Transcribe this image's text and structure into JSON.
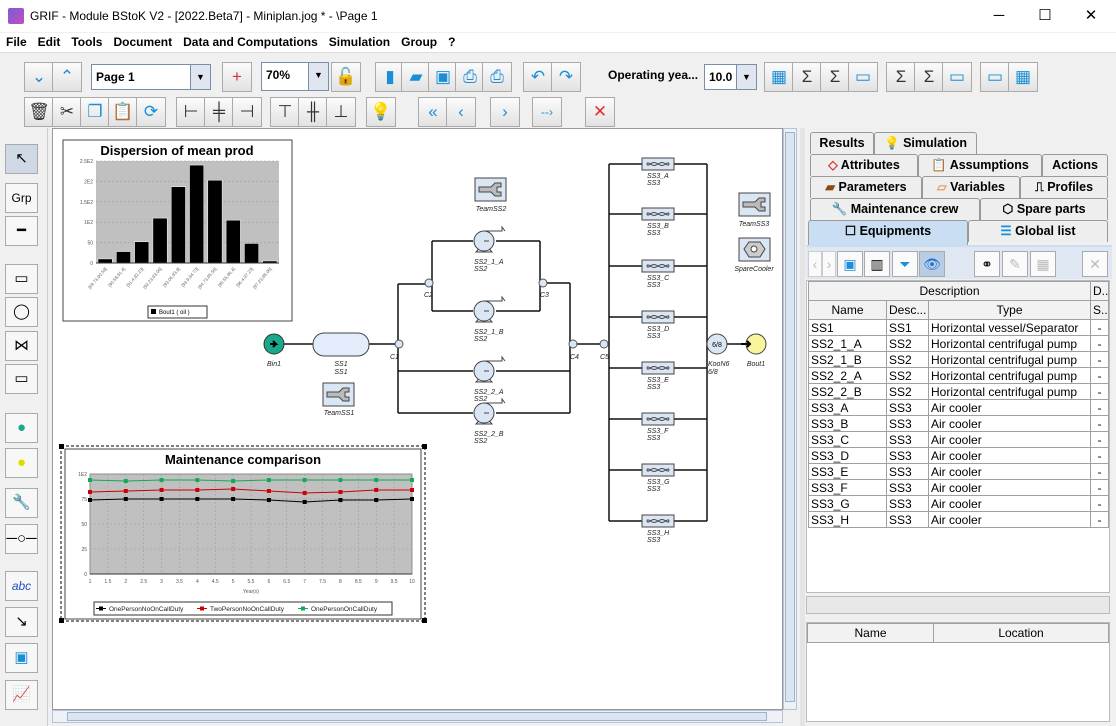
{
  "window": {
    "title": "GRIF - Module BStoK V2 - [2022.Beta7] - Miniplan.jog *  - \\Page 1",
    "minimize": "─",
    "maximize": "☐",
    "close": "✕"
  },
  "menu": [
    "File",
    "Edit",
    "Tools",
    "Document",
    "Data and Computations",
    "Simulation",
    "Group",
    "?"
  ],
  "toolbar": {
    "page_select": "Page 1",
    "zoom_select": "70%",
    "operating_label": "Operating yea...",
    "operating_value": "10.0",
    "row1_icons": [
      "chevron-down-icon",
      "chevron-up-icon",
      "new-page-icon",
      "lock-open-icon",
      "new-document-icon",
      "open-folder-icon",
      "save-icon",
      "print-icon",
      "print-check-icon",
      "undo-icon",
      "redo-icon"
    ],
    "row1_right_icons": [
      "calendar-gear-icon",
      "sigma-gear-icon",
      "sigma-icon",
      "monitor-gear-icon",
      "sigma-cloud-gear-icon",
      "sigma-cloud-icon",
      "monitor-cloud-icon",
      "monitor-status-icon",
      "calendar-icon"
    ],
    "row2_icons": [
      "trash-icon",
      "scissors-icon",
      "copy-icon",
      "paste-icon",
      "refresh-icon",
      "align-left-icon",
      "align-center-icon",
      "align-right-icon",
      "align-top-icon",
      "align-middle-icon",
      "align-bottom-icon",
      "lightbulb-icon",
      "double-left-icon",
      "left-icon",
      "right-icon",
      "dashed-arrow-icon",
      "lightbulb-off-icon"
    ]
  },
  "palette": {
    "group_label": "Grp",
    "text_label": "abc",
    "icons": [
      "pointer-icon",
      "group-icon",
      "line-icon",
      "rectangle-icon",
      "circle-icon",
      "valve-icon",
      "block-icon",
      "source-icon",
      "target-icon",
      "maintenance-icon",
      "connector-icon",
      "text-icon",
      "arrow-icon",
      "image-icon",
      "chart-icon"
    ]
  },
  "diagram": {
    "nodes": {
      "bin": "Bin1",
      "bout": "Bout1",
      "ss1": "SS1",
      "ss1_desc": "SS1",
      "team_ss1": "TeamSS1",
      "team_ss2": "TeamSS2",
      "team_ss3": "TeamSS3",
      "spare": "SpareCooler",
      "koon": "KooN6",
      "koon_value": "6/8",
      "koon_sub": "6/8"
    },
    "connectors": [
      "C1",
      "C2",
      "C3",
      "C4",
      "C5"
    ],
    "pumps": [
      {
        "name": "SS2_1_A",
        "desc": "SS2"
      },
      {
        "name": "SS2_1_B",
        "desc": "SS2"
      },
      {
        "name": "SS2_2_A",
        "desc": "SS2"
      },
      {
        "name": "SS2_2_B",
        "desc": "SS2"
      }
    ],
    "coolers": [
      {
        "name": "SS3_A",
        "desc": "SS3"
      },
      {
        "name": "SS3_B",
        "desc": "SS3"
      },
      {
        "name": "SS3_C",
        "desc": "SS3"
      },
      {
        "name": "SS3_D",
        "desc": "SS3"
      },
      {
        "name": "SS3_E",
        "desc": "SS3"
      },
      {
        "name": "SS3_F",
        "desc": "SS3"
      },
      {
        "name": "SS3_G",
        "desc": "SS3"
      },
      {
        "name": "SS3_H",
        "desc": "SS3"
      }
    ]
  },
  "chart_data": [
    {
      "type": "bar",
      "title": "Dispersion of mean prod",
      "categories": [
        "[69.73,90.58[",
        "[90.58,91.4[",
        "[91.4,92.23[",
        "[92.23,93.06[",
        "[93.06,93.9[",
        "[93.9,94.73[",
        "[94.73,95.56[",
        "[95.56,96.4[",
        "[96.4,97.23[",
        "[97.23,98.06["
      ],
      "values": [
        10,
        28,
        52,
        110,
        187,
        240,
        203,
        105,
        48,
        5
      ],
      "ylim": [
        0,
        250
      ],
      "yticks": [
        "0",
        "50",
        "1E2",
        "1.5E2",
        "2E2",
        "2.5E2"
      ],
      "legend": "Bout1 ( oil )",
      "legend_position": "bottom",
      "grid": true,
      "color": "#000000"
    },
    {
      "type": "line",
      "title": "Maintenance comparison",
      "xlabel": "Year(s)",
      "ylim": [
        0,
        100
      ],
      "xlim": [
        1,
        10
      ],
      "yticks": [
        "0",
        "25",
        "50",
        "75",
        "1E2"
      ],
      "xticks": [
        "1",
        "1.5",
        "2",
        "2.5",
        "3",
        "3.5",
        "4",
        "4.5",
        "5",
        "5.5",
        "6",
        "6.5",
        "7",
        "7.5",
        "8",
        "8.5",
        "9",
        "9.5",
        "10"
      ],
      "x": [
        1,
        2,
        3,
        4,
        5,
        6,
        7,
        8,
        9,
        10
      ],
      "legend_position": "bottom",
      "grid": true,
      "series": [
        {
          "name": "OnePersonNoOnCallDuty",
          "color": "#000000",
          "values": [
            74,
            75,
            75,
            75,
            75,
            74,
            72,
            74,
            74,
            75
          ]
        },
        {
          "name": "TwoPersonNoOnCallDuty",
          "color": "#cc0000",
          "values": [
            82,
            83,
            84,
            84,
            85,
            83,
            81,
            82,
            84,
            84
          ]
        },
        {
          "name": "OnePersonOnCallDuty",
          "color": "#11aa55",
          "values": [
            94,
            93,
            94,
            94,
            93,
            94,
            94,
            94,
            94,
            94
          ]
        }
      ]
    }
  ],
  "panel": {
    "tabs": [
      [
        "Results",
        "Simulation"
      ],
      [
        "Attributes",
        "Assumptions",
        "Actions"
      ],
      [
        "Parameters",
        "Variables",
        "Profiles"
      ],
      [
        "Maintenance crew",
        "Spare parts"
      ],
      [
        "Equipments",
        "Global list"
      ]
    ],
    "selected_tab": "Equipments",
    "table": {
      "group_header": "Description",
      "group_header2": "D...",
      "columns": [
        "Name",
        "Desc...",
        "Type",
        "S..."
      ],
      "rows": [
        [
          "SS1",
          "SS1",
          "Horizontal vessel/Separator",
          "-"
        ],
        [
          "SS2_1_A",
          "SS2",
          "Horizontal centrifugal pump",
          "-"
        ],
        [
          "SS2_1_B",
          "SS2",
          "Horizontal centrifugal pump",
          "-"
        ],
        [
          "SS2_2_A",
          "SS2",
          "Horizontal centrifugal pump",
          "-"
        ],
        [
          "SS2_2_B",
          "SS2",
          "Horizontal centrifugal pump",
          "-"
        ],
        [
          "SS3_A",
          "SS3",
          "Air cooler",
          "-"
        ],
        [
          "SS3_B",
          "SS3",
          "Air cooler",
          "-"
        ],
        [
          "SS3_C",
          "SS3",
          "Air cooler",
          "-"
        ],
        [
          "SS3_D",
          "SS3",
          "Air cooler",
          "-"
        ],
        [
          "SS3_E",
          "SS3",
          "Air cooler",
          "-"
        ],
        [
          "SS3_F",
          "SS3",
          "Air cooler",
          "-"
        ],
        [
          "SS3_G",
          "SS3",
          "Air cooler",
          "-"
        ],
        [
          "SS3_H",
          "SS3",
          "Air cooler",
          "-"
        ]
      ]
    },
    "location_table": {
      "columns": [
        "Name",
        "Location"
      ]
    }
  }
}
